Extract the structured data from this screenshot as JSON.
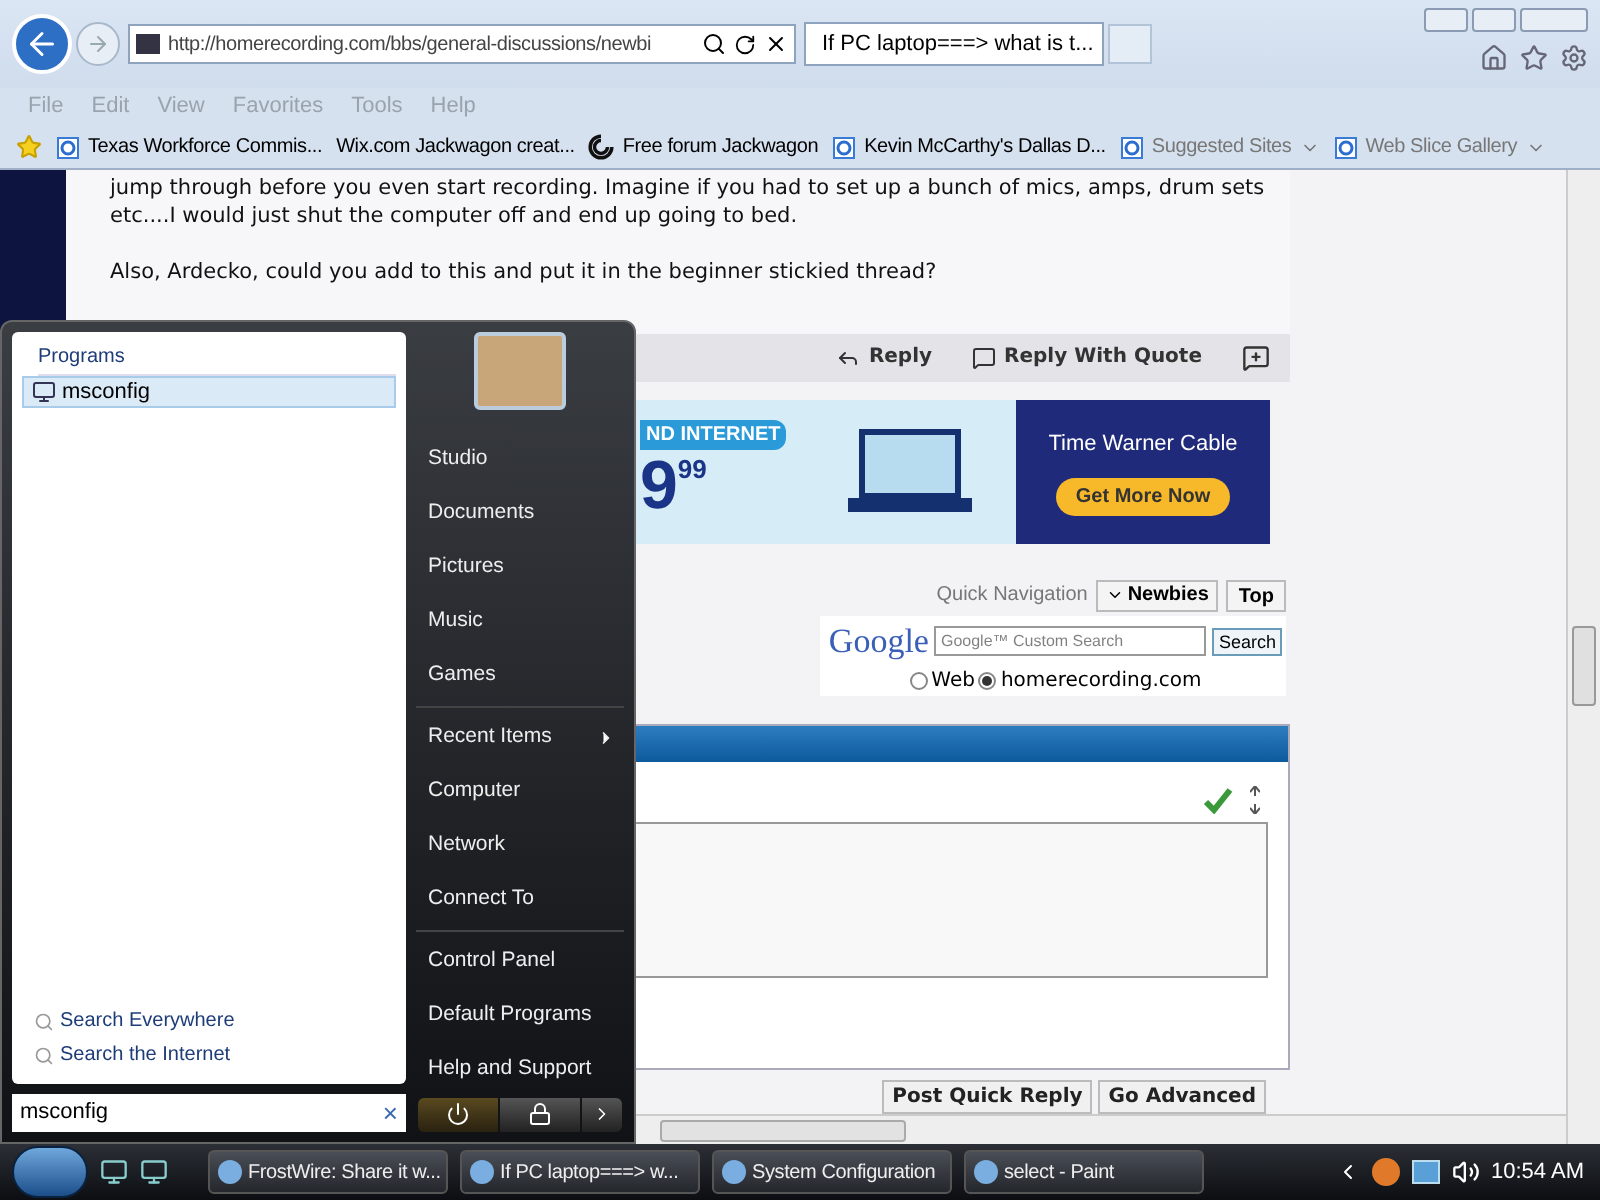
{
  "browser": {
    "address": "http://homerecording.com/bbs/general-discussions/newbi",
    "tab_title": "If PC laptop===> what is t...",
    "menu": [
      "File",
      "Edit",
      "View",
      "Favorites",
      "Tools",
      "Help"
    ],
    "favorites": [
      {
        "label": "Texas Workforce Commis...",
        "kind": "page"
      },
      {
        "label": "Wix.com Jackwagon creat...",
        "kind": "plain"
      },
      {
        "label": "Free forum  Jackwagon",
        "kind": "swirl"
      },
      {
        "label": "Kevin McCarthy's Dallas D...",
        "kind": "page"
      },
      {
        "label": "Suggested Sites",
        "kind": "dropdown"
      },
      {
        "label": "Web Slice Gallery",
        "kind": "dropdown"
      }
    ]
  },
  "post": {
    "paragraphs": [
      "jump through before you even start recording. Imagine if you had to set up a bunch of mics, amps, drum sets etc....I would just shut the computer off and end up going to bed.",
      "Also, Ardecko, could you add to this and put it in the beginner stickied thread?"
    ],
    "actions": [
      "Reply",
      "Reply With Quote"
    ]
  },
  "ad": {
    "banner": "ND INTERNET",
    "price": "9",
    "cents": "99",
    "brand": "Time Warner Cable",
    "cta": "Get More Now"
  },
  "quick_nav": {
    "label": "Quick Navigation",
    "forum": "Newbies",
    "top": "Top"
  },
  "google_search": {
    "logo": "Google",
    "placeholder": "Google™ Custom Search",
    "button": "Search",
    "options": [
      {
        "label": "Web",
        "selected": false
      },
      {
        "label": "homerecording.com",
        "selected": true
      }
    ]
  },
  "quick_reply": {
    "buttons": [
      "Post Quick Reply",
      "Go Advanced"
    ]
  },
  "start_menu": {
    "heading": "Programs",
    "results": [
      {
        "label": "msconfig",
        "selected": true
      }
    ],
    "search_links": [
      "Search Everywhere",
      "Search the Internet"
    ],
    "search_value": "msconfig",
    "clear": "×",
    "places": [
      [
        "Studio",
        "Documents",
        "Pictures",
        "Music",
        "Games"
      ],
      [
        "Recent Items",
        "Computer",
        "Network",
        "Connect To"
      ],
      [
        "Control Panel",
        "Default Programs",
        "Help and Support"
      ]
    ]
  },
  "taskbar": {
    "tasks": [
      "FrostWire: Share it w...",
      "If PC laptop===> w...",
      "System Configuration",
      "select - Paint"
    ],
    "clock": "10:54 AM"
  }
}
